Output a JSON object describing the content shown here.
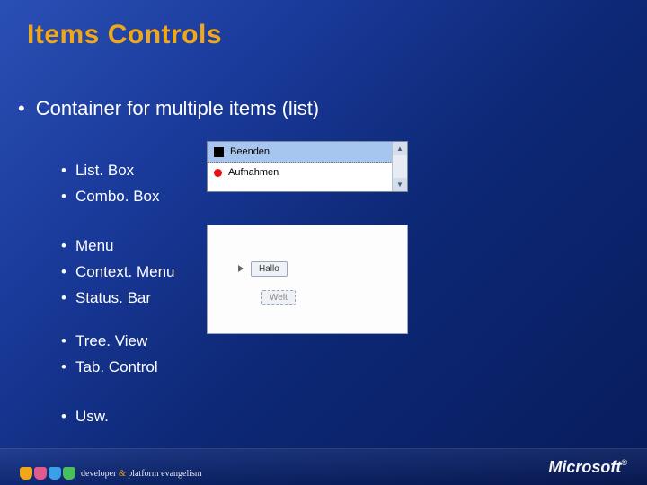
{
  "title": "Items Controls",
  "subtitle": "Container for multiple items (list)",
  "groups": {
    "g1": [
      "List. Box",
      "Combo. Box"
    ],
    "g2": [
      "Menu",
      "Context. Menu",
      "Status. Bar"
    ],
    "g3": [
      "Tree. View",
      "Tab. Control"
    ],
    "g4": [
      "Usw."
    ]
  },
  "listbox": {
    "selected": "Beenden",
    "other": "Aufnahmen"
  },
  "canvas": {
    "btn1": "Hallo",
    "btn2": "Welt"
  },
  "footer": {
    "dev_prefix": "developer",
    "amp": "&",
    "dev_suffix": "platform evangelism",
    "ms": "Microsoft"
  }
}
